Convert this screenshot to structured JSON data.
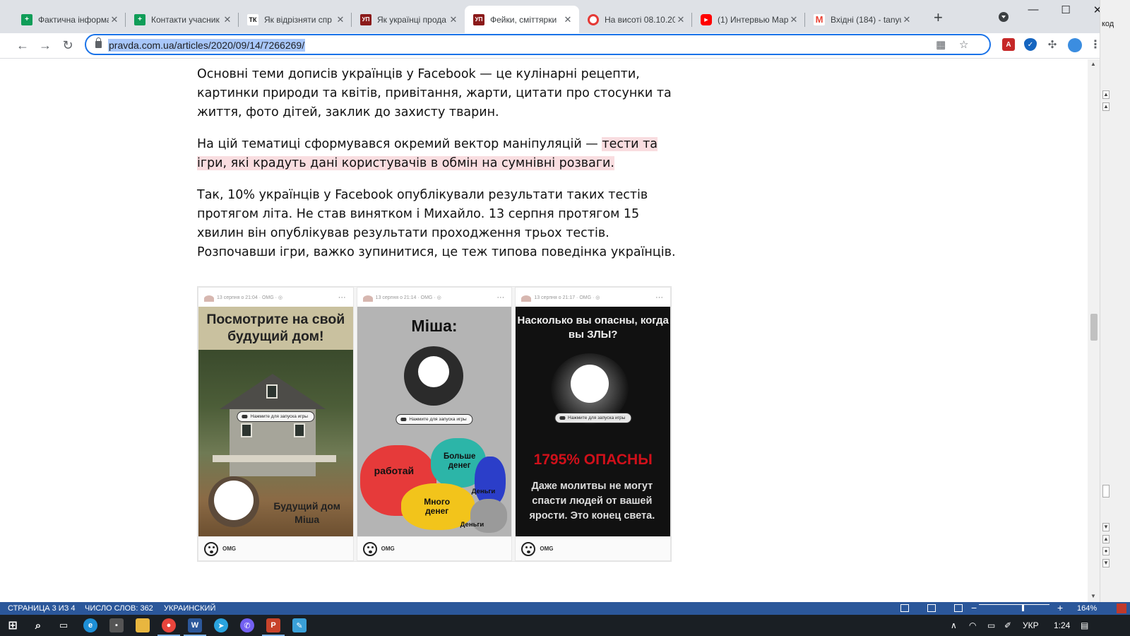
{
  "browser": {
    "tabs": [
      {
        "title": "Фактична інформа",
        "favicon": "green-sheets-icon",
        "color": "#0f9d58"
      },
      {
        "title": "Контакти учасник",
        "favicon": "green-sheets-icon",
        "color": "#0f9d58"
      },
      {
        "title": "Як відрізняти спр",
        "favicon": "tk-icon",
        "color": "#222222",
        "favicon_text": "ТК"
      },
      {
        "title": "Як українці прода",
        "favicon": "up-icon",
        "color": "#8b1a1a",
        "favicon_text": "УП"
      },
      {
        "title": "Фейки, сміттярки",
        "favicon": "up-icon",
        "color": "#8b1a1a",
        "favicon_text": "УП",
        "active": true
      },
      {
        "title": "На висоті 08.10.20",
        "favicon": "red-circle-icon",
        "color": "#e53935"
      },
      {
        "title": "(1) Интервью Мар",
        "favicon": "youtube-icon",
        "color": "#ff0000"
      },
      {
        "title": "Вхідні (184) - tanyu",
        "favicon": "gmail-icon",
        "color": "#ea4335"
      }
    ],
    "new_tab": "+",
    "window": {
      "minimize": "—",
      "maximize": "☐",
      "close": "✕"
    },
    "url": "pravda.com.ua/articles/2020/09/14/7266269/"
  },
  "article": {
    "p1": "Основні теми дописів українців у Facebook — це кулінарні рецепти, картинки природи та квітів, привітання, жарти, цитати про стосунки та життя, фото дітей, заклик до захисту тварин.",
    "p2_plain": "На цій тематиці сформувався окремий вектор маніпуляцій — ",
    "p2_highlight_line1": "тести та",
    "p2_highlight_line2": "ігри, які крадуть дані користувачів в обмін на сумнівні розваги.",
    "p3": "Так, 10% українців у Facebook опублікували результати таких тестів протягом літа. Не став винятком і Михайло. 13 серпня протягом 15 хвилин він опублікував результати проходження трьох тестів. Розпочавши ігри, важко зупинитися, це теж типова поведінка українців."
  },
  "cards": [
    {
      "meta": "13 серпня о 21:04 · OMG · ◎",
      "headline": "Посмотрите на свой будущий дом!",
      "caption": "Будущий дом Міша",
      "pill": "Нажмите для запуска игры",
      "app": "OMG"
    },
    {
      "meta": "13 серпня о 21:14 · OMG · ◎",
      "headline": "Міша:",
      "pill": "Нажмите для запуска игры",
      "lobes": [
        "работай",
        "Больше денег",
        "Деньги",
        "Много денег",
        "Деньги"
      ],
      "app": "OMG"
    },
    {
      "meta": "13 серпня о 21:17 · OMG · ◎",
      "headline": "Насколько вы опасны, когда вы ЗЛЫ?",
      "pill": "Нажмите для запуска игры",
      "result": "1795% ОПАСНЫ",
      "caption": "Даже молитвы не могут спасти людей от вашей ярости. Это конец света.",
      "app": "OMG"
    }
  ],
  "word": {
    "side_label": "код",
    "page": "СТРАНИЦА 3 ИЗ 4",
    "words": "ЧИСЛО СЛОВ: 362",
    "language": "УКРАИНСКИЙ",
    "zoom": "164%",
    "zoom_minus": "−",
    "zoom_plus": "+"
  },
  "taskbar": {
    "language": "УКР",
    "time": "1:24",
    "apps": [
      "windows-start-icon",
      "search-icon",
      "task-view-icon",
      "edge-icon",
      "store-icon",
      "file-explorer-icon",
      "chrome-icon",
      "word-icon",
      "telegram-icon",
      "viber-icon",
      "powerpoint-icon",
      "paint-icon"
    ]
  },
  "colors": {
    "accent": "#1a73e8",
    "highlight": "#f9dde0",
    "word_blue": "#2b579a",
    "danger_red": "#d0101a"
  }
}
